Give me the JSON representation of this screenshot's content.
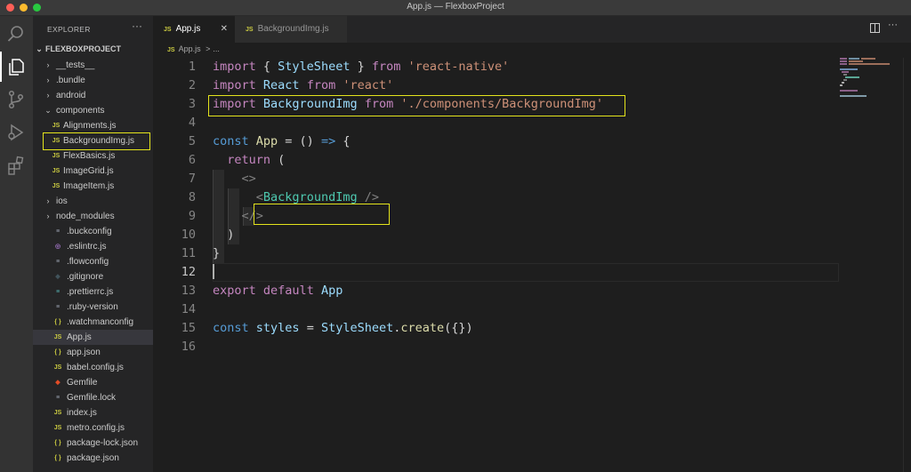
{
  "window": {
    "title": "App.js — FlexboxProject"
  },
  "activity_bar": {
    "icons": [
      "explorer-icon",
      "search-icon",
      "source-control-icon",
      "run-debug-icon",
      "extensions-icon"
    ]
  },
  "explorer": {
    "header": "EXPLORER",
    "more": "···",
    "project": "FLEXBOXPROJECT",
    "items": [
      {
        "label": "__tests__",
        "kind": "folder",
        "state": "collapsed",
        "depth": 1
      },
      {
        "label": ".bundle",
        "kind": "folder",
        "state": "collapsed",
        "depth": 1
      },
      {
        "label": "android",
        "kind": "folder",
        "state": "collapsed",
        "depth": 1
      },
      {
        "label": "components",
        "kind": "folder",
        "state": "expanded",
        "depth": 1
      },
      {
        "label": "Alignments.js",
        "kind": "js",
        "depth": 2
      },
      {
        "label": "BackgroundImg.js",
        "kind": "js",
        "depth": 2,
        "highlighted": true
      },
      {
        "label": "FlexBasics.js",
        "kind": "js",
        "depth": 2
      },
      {
        "label": "ImageGrid.js",
        "kind": "js",
        "depth": 2
      },
      {
        "label": "ImageItem.js",
        "kind": "js",
        "depth": 2
      },
      {
        "label": "ios",
        "kind": "folder",
        "state": "collapsed",
        "depth": 1
      },
      {
        "label": "node_modules",
        "kind": "folder",
        "state": "collapsed",
        "depth": 1
      },
      {
        "label": ".buckconfig",
        "kind": "lines",
        "depth": 1
      },
      {
        "label": ".eslintrc.js",
        "kind": "eslint",
        "depth": 1
      },
      {
        "label": ".flowconfig",
        "kind": "lines",
        "depth": 1
      },
      {
        "label": ".gitignore",
        "kind": "git",
        "depth": 1
      },
      {
        "label": ".prettierrc.js",
        "kind": "prettier",
        "depth": 1
      },
      {
        "label": ".ruby-version",
        "kind": "lines",
        "depth": 1
      },
      {
        "label": ".watchmanconfig",
        "kind": "json",
        "depth": 1
      },
      {
        "label": "App.js",
        "kind": "js",
        "depth": 1,
        "selected": true
      },
      {
        "label": "app.json",
        "kind": "json",
        "depth": 1
      },
      {
        "label": "babel.config.js",
        "kind": "js",
        "depth": 1
      },
      {
        "label": "Gemfile",
        "kind": "ruby",
        "depth": 1
      },
      {
        "label": "Gemfile.lock",
        "kind": "lines",
        "depth": 1
      },
      {
        "label": "index.js",
        "kind": "js",
        "depth": 1
      },
      {
        "label": "metro.config.js",
        "kind": "js",
        "depth": 1
      },
      {
        "label": "package-lock.json",
        "kind": "json",
        "depth": 1
      },
      {
        "label": "package.json",
        "kind": "json",
        "depth": 1
      }
    ]
  },
  "tabs": [
    {
      "label": "App.js",
      "active": true,
      "close": "✕"
    },
    {
      "label": "BackgroundImg.js",
      "active": false
    }
  ],
  "breadcrumb": {
    "file": "App.js",
    "sep": ">",
    "rest": "..."
  },
  "editor": {
    "current_line": 12,
    "lines": [
      {
        "n": "1",
        "tokens": [
          [
            "kw",
            "import"
          ],
          [
            "txt",
            " { "
          ],
          [
            "var",
            "StyleSheet"
          ],
          [
            "txt",
            " } "
          ],
          [
            "kw",
            "from"
          ],
          [
            "txt",
            " "
          ],
          [
            "str",
            "'react-native'"
          ]
        ]
      },
      {
        "n": "2",
        "tokens": [
          [
            "kw",
            "import"
          ],
          [
            "txt",
            " "
          ],
          [
            "var",
            "React"
          ],
          [
            "txt",
            " "
          ],
          [
            "kw",
            "from"
          ],
          [
            "txt",
            " "
          ],
          [
            "str",
            "'react'"
          ]
        ]
      },
      {
        "n": "3",
        "tokens": [
          [
            "kw",
            "import"
          ],
          [
            "txt",
            " "
          ],
          [
            "var",
            "BackgroundImg"
          ],
          [
            "txt",
            " "
          ],
          [
            "kw",
            "from"
          ],
          [
            "txt",
            " "
          ],
          [
            "str",
            "'./components/BackgroundImg'"
          ]
        ]
      },
      {
        "n": "4",
        "tokens": []
      },
      {
        "n": "5",
        "tokens": [
          [
            "kw2",
            "const"
          ],
          [
            "txt",
            " "
          ],
          [
            "fn",
            "App"
          ],
          [
            "txt",
            " = () "
          ],
          [
            "kw2",
            "=>"
          ],
          [
            "txt",
            " {"
          ]
        ]
      },
      {
        "n": "6",
        "tokens": [
          [
            "txt",
            "  "
          ],
          [
            "kw",
            "return"
          ],
          [
            "txt",
            " ("
          ]
        ]
      },
      {
        "n": "7",
        "tokens": [
          [
            "txt",
            "    "
          ],
          [
            "pun",
            "<>"
          ]
        ]
      },
      {
        "n": "8",
        "tokens": [
          [
            "txt",
            "      "
          ],
          [
            "pun",
            "<"
          ],
          [
            "tag",
            "BackgroundImg"
          ],
          [
            "txt",
            " "
          ],
          [
            "pun",
            "/>"
          ]
        ]
      },
      {
        "n": "9",
        "tokens": [
          [
            "txt",
            "    "
          ],
          [
            "pun",
            "</>"
          ]
        ]
      },
      {
        "n": "10",
        "tokens": [
          [
            "txt",
            "  )"
          ]
        ]
      },
      {
        "n": "11",
        "tokens": [
          [
            "txt",
            "}"
          ]
        ]
      },
      {
        "n": "12",
        "tokens": []
      },
      {
        "n": "13",
        "tokens": [
          [
            "kw",
            "export"
          ],
          [
            "txt",
            " "
          ],
          [
            "kw",
            "default"
          ],
          [
            "txt",
            " "
          ],
          [
            "var",
            "App"
          ]
        ]
      },
      {
        "n": "14",
        "tokens": []
      },
      {
        "n": "15",
        "tokens": [
          [
            "kw2",
            "const"
          ],
          [
            "txt",
            " "
          ],
          [
            "var",
            "styles"
          ],
          [
            "txt",
            " = "
          ],
          [
            "var",
            "StyleSheet"
          ],
          [
            "txt",
            "."
          ],
          [
            "fn",
            "create"
          ],
          [
            "txt",
            "({})"
          ]
        ]
      },
      {
        "n": "16",
        "tokens": []
      }
    ]
  },
  "colors": {
    "highlight_box": "#e4e41c",
    "js_icon": "#cbcb41",
    "keyword": "#c586c0",
    "storage": "#569cd6",
    "string": "#ce9178",
    "variable": "#9cdcfe",
    "function": "#dcdcaa",
    "tag": "#4ec9b0"
  }
}
